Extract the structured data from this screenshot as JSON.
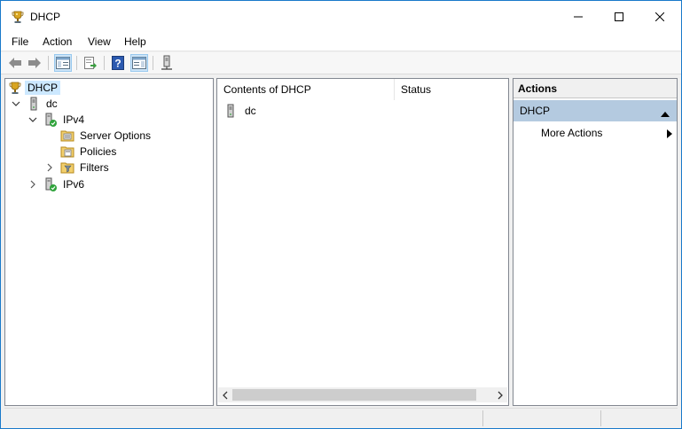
{
  "window": {
    "title": "DHCP",
    "app_icon": "dhcp-trophy-icon"
  },
  "menu": {
    "items": [
      "File",
      "Action",
      "View",
      "Help"
    ]
  },
  "toolbar": {
    "buttons": [
      "back-arrow-icon",
      "forward-arrow-icon",
      "show-hide-console-tree-icon",
      "export-list-icon",
      "help-icon",
      "show-hide-action-pane-icon",
      "server-icon"
    ]
  },
  "tree": {
    "root": "DHCP",
    "server": "dc",
    "ipv4": "IPv4",
    "server_options": "Server Options",
    "policies": "Policies",
    "filters": "Filters",
    "ipv6": "IPv6"
  },
  "content": {
    "columns": [
      "Contents of DHCP",
      "Status"
    ],
    "rows": [
      {
        "name": "dc",
        "status": ""
      }
    ]
  },
  "actions": {
    "header": "Actions",
    "group": "DHCP",
    "items": [
      "More Actions"
    ]
  },
  "colors": {
    "selection": "#cce8ff",
    "actions_group_bg": "#b4cae0",
    "window_border": "#1979ca"
  }
}
